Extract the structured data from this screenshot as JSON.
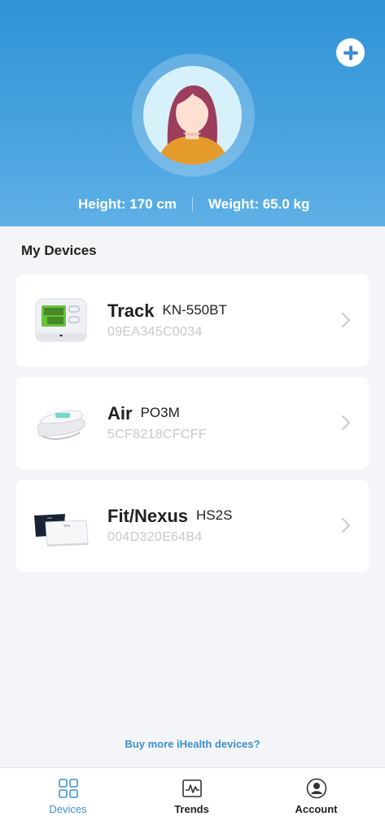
{
  "colors": {
    "header_gradient_top": "#2f93d6",
    "header_gradient_bottom": "#5fb0e6",
    "accent": "#3d8fd0",
    "background": "#f3f5f9",
    "card": "#ffffff",
    "muted_text": "#c8c8c8"
  },
  "header": {
    "add_icon": "plus-circle-icon",
    "avatar_icon": "user-avatar-icon",
    "height_text": "Height: 170 cm",
    "weight_text": "Weight: 65.0 kg"
  },
  "devices_section": {
    "title": "My Devices",
    "devices": [
      {
        "name": "Track",
        "model": "KN-550BT",
        "id": "09EA345C0034",
        "icon": "blood-pressure-monitor-icon"
      },
      {
        "name": "Air",
        "model": "PO3M",
        "id": "5CF8218CFCFF",
        "icon": "pulse-oximeter-icon"
      },
      {
        "name": "Fit/Nexus",
        "model": "HS2S",
        "id": "004D320E64B4",
        "icon": "smart-scale-icon"
      }
    ]
  },
  "buy_link": "Buy more iHealth devices?",
  "tabbar": {
    "tabs": [
      {
        "label": "Devices",
        "icon": "devices-grid-icon",
        "active": true
      },
      {
        "label": "Trends",
        "icon": "trends-chart-icon",
        "active": false
      },
      {
        "label": "Account",
        "icon": "account-icon",
        "active": false
      }
    ]
  }
}
